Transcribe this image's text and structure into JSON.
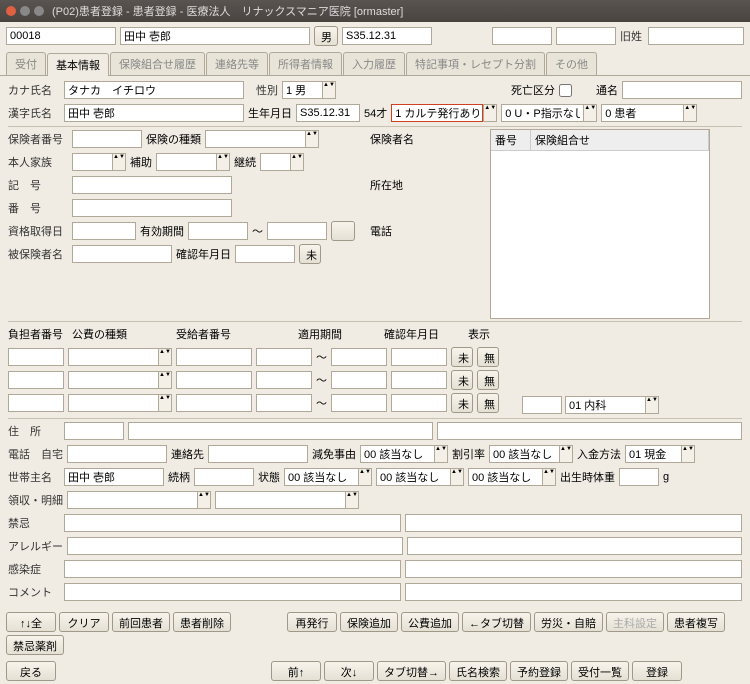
{
  "title": "(P02)患者登録 - 患者登録 - 医療法人　リナックスマニア医院 [ormaster]",
  "top": {
    "id": "00018",
    "name": "田中 壱郎",
    "sex": "男",
    "birth": "S35.12.31",
    "old_name_lbl": "旧姓"
  },
  "tabs": [
    "受付",
    "基本情報",
    "保険組合せ履歴",
    "連絡先等",
    "所得者情報",
    "入力履歴",
    "特記事項・レセプト分割",
    "その他"
  ],
  "active_tab": 1,
  "basic": {
    "kana_lbl": "カナ氏名",
    "kana": "タナカ　イチロウ",
    "sex_lbl": "性別",
    "sex": "1 男",
    "kanji_lbl": "漢字氏名",
    "kanji": "田中 壱郎",
    "birth_lbl": "生年月日",
    "birth": "S35.12.31",
    "age": "54才",
    "karte": "1 カルテ発行あり",
    "up": "0 U・P指示なし",
    "pt": "0 患者",
    "death_lbl": "死亡区分",
    "tsusho_lbl": "通名"
  },
  "ins": {
    "num_lbl": "保険者番号",
    "type_lbl": "保険の種類",
    "fam_lbl": "本人家族",
    "hojo_lbl": "補助",
    "keizoku_lbl": "継続",
    "kigo_lbl": "記　号",
    "bango_lbl": "番　号",
    "shutoku_lbl": "資格取得日",
    "yukou_lbl": "有効期間",
    "tilde": "～",
    "hihoken_lbl": "被保険者名",
    "kakunin_lbl": "確認年月日",
    "mi": "未",
    "hokensha_lbl": "保険者名",
    "shozai_lbl": "所在地",
    "tel_lbl": "電話",
    "list_h1": "番号",
    "list_h2": "保険組合せ",
    "dept": "01 内科"
  },
  "kouhi": {
    "futan_lbl": "負担者番号",
    "type_lbl": "公費の種類",
    "jukyuu_lbl": "受給者番号",
    "kikan_lbl": "適用期間",
    "kakunin_lbl": "確認年月日",
    "hyouji_lbl": "表示",
    "mi": "未",
    "mu": "無"
  },
  "addr": {
    "jusho_lbl": "住　所",
    "tel_lbl": "電話　自宅",
    "renraku_lbl": "連絡先",
    "genmen_lbl": "減免事由",
    "genmen": "00 該当なし",
    "wari_lbl": "割引率",
    "wari": "00 該当なし",
    "nyukin_lbl": "入金方法",
    "nyukin": "01 現金",
    "setai_lbl": "世帯主名",
    "setai": "田中 壱郎",
    "zoku_lbl": "続柄",
    "jotai_lbl": "状態",
    "jotai": "00 該当なし",
    "j2": "00 該当なし",
    "j3": "00 該当なし",
    "taiju_lbl": "出生時体重",
    "g": "g",
    "ryoshu_lbl": "領収・明細",
    "kinki_lbl": "禁忌",
    "allergy_lbl": "アレルギー",
    "kansen_lbl": "感染症",
    "comment_lbl": "コメント"
  },
  "btns1": [
    "↑↓全",
    "クリア",
    "前回患者",
    "患者削除",
    "",
    "再発行",
    "保険追加",
    "公費追加",
    "←タブ切替",
    "労災・自賠",
    "主科設定",
    "患者複写",
    "禁忌薬剤"
  ],
  "btns2": [
    "戻る",
    "",
    "",
    "",
    "",
    "前↑",
    "次↓",
    "タブ切替→",
    "氏名検索",
    "予約登録",
    "受付一覧",
    "登録"
  ]
}
